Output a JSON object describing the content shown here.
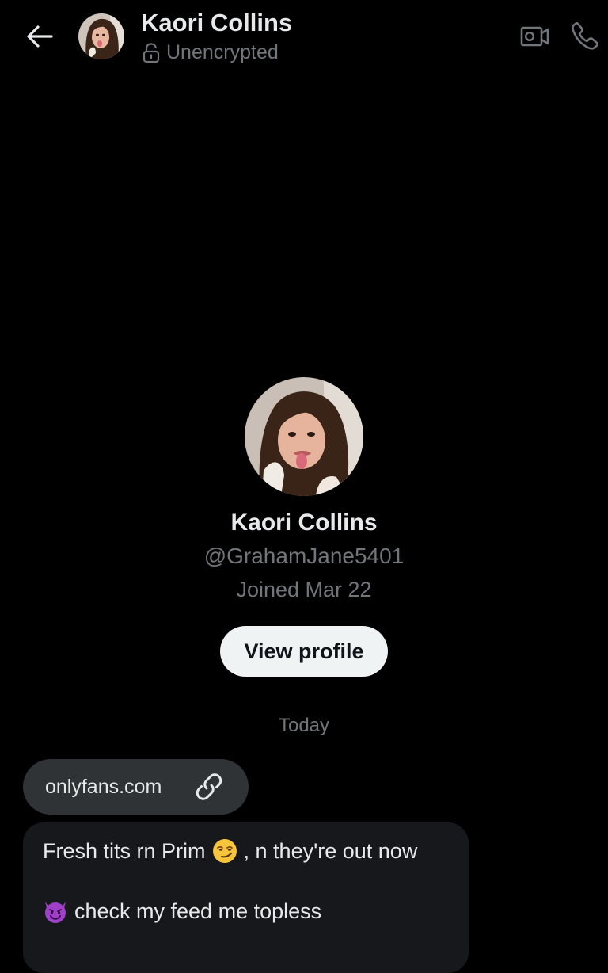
{
  "header": {
    "name": "Kaori Collins",
    "encryption_status": "Unencrypted",
    "icons": {
      "back": "back-arrow-icon",
      "lock": "unlocked-padlock-icon",
      "video": "video-call-icon",
      "call": "phone-call-icon"
    }
  },
  "profile": {
    "name": "Kaori Collins",
    "handle": "@GrahamJane5401",
    "joined": "Joined Mar 22",
    "view_profile_label": "View profile"
  },
  "conversation": {
    "day_label": "Today",
    "messages": [
      {
        "type": "link",
        "text": "onlyfans.com",
        "icon": "link-icon"
      },
      {
        "type": "text",
        "line1_a": "Fresh tits rn Prim",
        "line1_emoji": "smirking-face-emoji",
        "line1_b": ", n  they're out now",
        "line2_emoji": "smiling-devil-emoji",
        "line2_text": "check my feed me topless"
      }
    ]
  },
  "colors": {
    "background": "#000000",
    "primary_text": "#e7e9ea",
    "secondary_text": "#71767b",
    "button_bg": "#eff3f4",
    "link_bubble_bg": "#2f3336",
    "message_bubble_bg": "#16181c"
  }
}
